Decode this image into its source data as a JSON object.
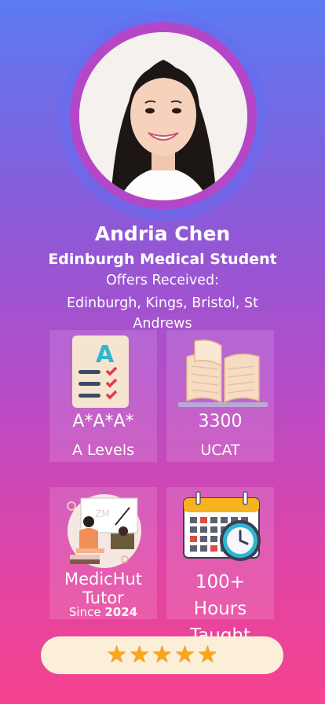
{
  "profile": {
    "name": "Andria Chen",
    "role": "Edinburgh Medical Student",
    "offers_label": "Offers Received:",
    "offers": "Edinburgh, Kings, Bristol, St Andrews"
  },
  "stats": [
    {
      "value": "A*A*A*",
      "label": "A Levels",
      "icon": "checklist-icon"
    },
    {
      "value": "3300",
      "label": "UCAT",
      "icon": "open-book-icon"
    },
    {
      "value": "MedicHut Tutor",
      "label_prefix": "Since",
      "label_year": "2024",
      "icon": "tutor-illustration"
    },
    {
      "value": "100+ Hours Taught",
      "icon": "calendar-clock-icon"
    }
  ],
  "rating": {
    "stars": 5,
    "max": 5
  },
  "colors": {
    "gradient_top": "#5b7bf2",
    "gradient_bottom": "#f5438f",
    "avatar_ring": "#b447c7",
    "star": "#f8a61a",
    "rating_bg": "#fbefd8"
  }
}
